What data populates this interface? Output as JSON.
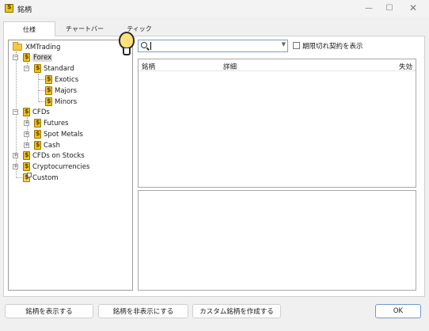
{
  "window": {
    "title": "銘柄"
  },
  "tabs": [
    {
      "label": "仕様"
    },
    {
      "label": "チャートバー"
    },
    {
      "label": "ティック"
    }
  ],
  "tree": {
    "root": "XMTrading",
    "forex": "Forex",
    "standard": "Standard",
    "exotics": "Exotics",
    "majors": "Majors",
    "minors": "Minors",
    "cfds": "CFDs",
    "futures": "Futures",
    "spot_metals": "Spot Metals",
    "cash": "Cash",
    "cfds_on_stocks": "CFDs on Stocks",
    "crypto": "Cryptocurrencies",
    "custom": "Custom"
  },
  "search": {
    "value": ""
  },
  "filter": {
    "expired_label": "期限切れ契約を表示"
  },
  "table": {
    "columns": [
      "銘柄",
      "詳細",
      "失効"
    ]
  },
  "buttons": {
    "show": "銘柄を表示する",
    "hide": "銘柄を非表示にする",
    "create_custom": "カスタム銘柄を作成する",
    "ok": "OK"
  },
  "window_controls": {
    "minimize": "—",
    "maximize": "☐",
    "close": "✕"
  }
}
